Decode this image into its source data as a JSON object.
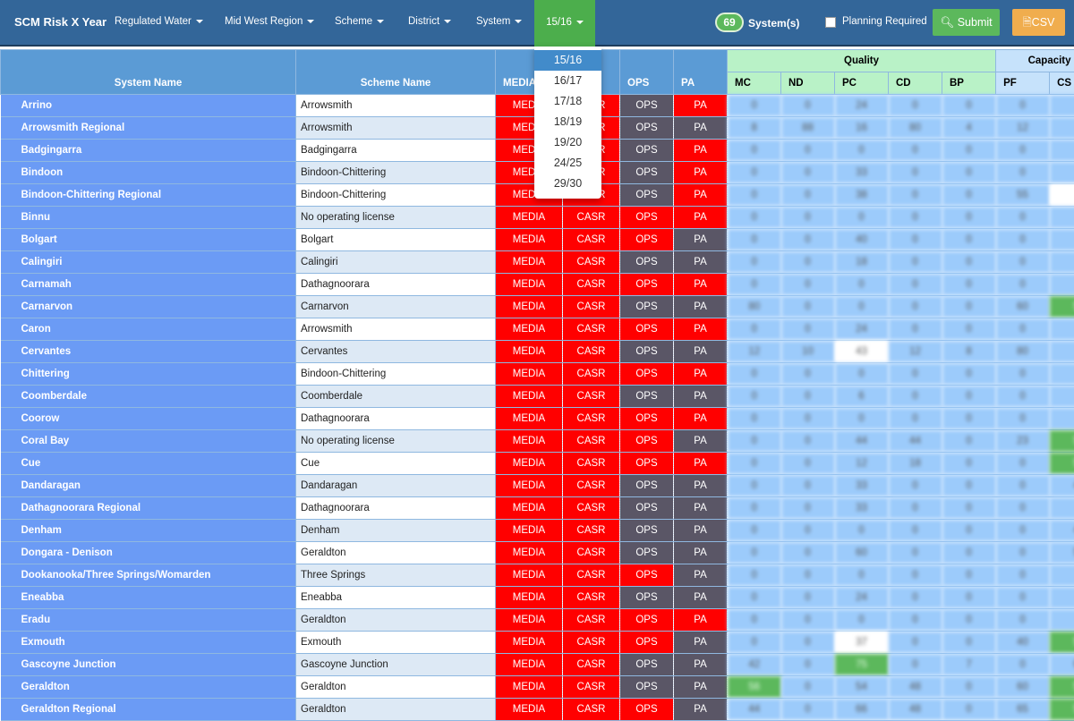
{
  "nav": {
    "title": "SCM Risk X Year",
    "filters": [
      "Regulated Water",
      "Mid West Region",
      "Scheme",
      "District",
      "System"
    ],
    "year": "15/16",
    "system_count": "69",
    "system_label": "System(s)",
    "planning_label": "Planning Required",
    "planning_checked": false,
    "submit_label": "Submit",
    "csv_label": "CSV"
  },
  "year_menu": {
    "options": [
      "15/16",
      "16/17",
      "17/18",
      "18/19",
      "19/20",
      "24/25",
      "29/30"
    ],
    "selected": "15/16"
  },
  "colors": {
    "navbar": "#336699",
    "red": "#ff0000",
    "dark": "#5a5666",
    "green": "#5cb85c",
    "orange": "#f0ad4e"
  },
  "table": {
    "headers": {
      "system": "System Name",
      "scheme": "Scheme Name",
      "media": "MEDIA",
      "casr": "CASR",
      "ops": "OPS",
      "pa": "PA",
      "quality": "Quality",
      "capacity": "Capacity",
      "quality_cols": [
        "MC",
        "ND",
        "PC",
        "CD",
        "BP"
      ],
      "capacity_cols": [
        "PF",
        "CS"
      ]
    },
    "rows": [
      {
        "system": "Arrino",
        "scheme": "Arrowsmith",
        "ops": "dark",
        "pa": "red",
        "v": [
          "0",
          "0",
          "24",
          "0",
          "0",
          "0",
          ""
        ],
        "hl": {}
      },
      {
        "system": "Arrowsmith Regional",
        "scheme": "Arrowsmith",
        "ops": "dark",
        "pa": "dark",
        "v": [
          "8",
          "88",
          "16",
          "80",
          "4",
          "12",
          ""
        ],
        "hl": {}
      },
      {
        "system": "Badgingarra",
        "scheme": "Badgingarra",
        "ops": "dark",
        "pa": "red",
        "v": [
          "0",
          "0",
          "0",
          "0",
          "0",
          "0",
          ""
        ],
        "hl": {}
      },
      {
        "system": "Bindoon",
        "scheme": "Bindoon-Chittering",
        "ops": "dark",
        "pa": "red",
        "v": [
          "0",
          "0",
          "33",
          "0",
          "0",
          "0",
          ""
        ],
        "hl": {}
      },
      {
        "system": "Bindoon-Chittering Regional",
        "scheme": "Bindoon-Chittering",
        "ops": "dark",
        "pa": "red",
        "v": [
          "0",
          "0",
          "38",
          "0",
          "0",
          "55",
          ""
        ],
        "hl": {
          "6": "white"
        }
      },
      {
        "system": "Binnu",
        "scheme": "No operating license",
        "ops": "red",
        "pa": "red",
        "v": [
          "0",
          "0",
          "0",
          "0",
          "0",
          "0",
          ""
        ],
        "hl": {}
      },
      {
        "system": "Bolgart",
        "scheme": "Bolgart",
        "ops": "red",
        "pa": "dark",
        "v": [
          "0",
          "0",
          "40",
          "0",
          "0",
          "0",
          ""
        ],
        "hl": {}
      },
      {
        "system": "Calingiri",
        "scheme": "Calingiri",
        "ops": "dark",
        "pa": "dark",
        "v": [
          "0",
          "0",
          "18",
          "0",
          "0",
          "0",
          ""
        ],
        "hl": {}
      },
      {
        "system": "Carnamah",
        "scheme": "Dathagnoorara",
        "ops": "red",
        "pa": "red",
        "v": [
          "0",
          "0",
          "0",
          "0",
          "0",
          "0",
          ""
        ],
        "hl": {}
      },
      {
        "system": "Carnarvon",
        "scheme": "Carnarvon",
        "ops": "dark",
        "pa": "dark",
        "v": [
          "80",
          "0",
          "0",
          "0",
          "0",
          "60",
          "5"
        ],
        "hl": {
          "6": "green"
        }
      },
      {
        "system": "Caron",
        "scheme": "Arrowsmith",
        "ops": "red",
        "pa": "red",
        "v": [
          "0",
          "0",
          "24",
          "0",
          "0",
          "0",
          ""
        ],
        "hl": {}
      },
      {
        "system": "Cervantes",
        "scheme": "Cervantes",
        "ops": "dark",
        "pa": "dark",
        "v": [
          "12",
          "10",
          "43",
          "12",
          "8",
          "80",
          ""
        ],
        "hl": {
          "2": "white"
        }
      },
      {
        "system": "Chittering",
        "scheme": "Bindoon-Chittering",
        "ops": "red",
        "pa": "red",
        "v": [
          "0",
          "0",
          "0",
          "0",
          "0",
          "0",
          ""
        ],
        "hl": {}
      },
      {
        "system": "Coomberdale",
        "scheme": "Coomberdale",
        "ops": "dark",
        "pa": "dark",
        "v": [
          "0",
          "0",
          "6",
          "0",
          "0",
          "0",
          ""
        ],
        "hl": {}
      },
      {
        "system": "Coorow",
        "scheme": "Dathagnoorara",
        "ops": "red",
        "pa": "red",
        "v": [
          "0",
          "0",
          "0",
          "0",
          "0",
          "0",
          ""
        ],
        "hl": {}
      },
      {
        "system": "Coral Bay",
        "scheme": "No operating license",
        "ops": "red",
        "pa": "dark",
        "v": [
          "0",
          "0",
          "44",
          "44",
          "0",
          "23",
          "5"
        ],
        "hl": {
          "6": "green"
        }
      },
      {
        "system": "Cue",
        "scheme": "Cue",
        "ops": "red",
        "pa": "red",
        "v": [
          "0",
          "0",
          "12",
          "18",
          "0",
          "0",
          "5"
        ],
        "hl": {
          "6": "green"
        }
      },
      {
        "system": "Dandaragan",
        "scheme": "Dandaragan",
        "ops": "dark",
        "pa": "dark",
        "v": [
          "0",
          "0",
          "33",
          "0",
          "0",
          "0",
          "4"
        ],
        "hl": {}
      },
      {
        "system": "Dathagnoorara Regional",
        "scheme": "Dathagnoorara",
        "ops": "dark",
        "pa": "dark",
        "v": [
          "0",
          "0",
          "33",
          "0",
          "0",
          "0",
          ""
        ],
        "hl": {}
      },
      {
        "system": "Denham",
        "scheme": "Denham",
        "ops": "dark",
        "pa": "dark",
        "v": [
          "0",
          "0",
          "0",
          "0",
          "0",
          "0",
          "4"
        ],
        "hl": {}
      },
      {
        "system": "Dongara - Denison",
        "scheme": "Geraldton",
        "ops": "dark",
        "pa": "dark",
        "v": [
          "0",
          "0",
          "60",
          "0",
          "0",
          "0",
          "5"
        ],
        "hl": {}
      },
      {
        "system": "Dookanooka/Three Springs/Womarden",
        "scheme": "Three Springs",
        "ops": "red",
        "pa": "dark",
        "v": [
          "0",
          "0",
          "0",
          "0",
          "0",
          "0",
          ""
        ],
        "hl": {}
      },
      {
        "system": "Eneabba",
        "scheme": "Eneabba",
        "ops": "dark",
        "pa": "dark",
        "v": [
          "0",
          "0",
          "24",
          "0",
          "0",
          "0",
          ""
        ],
        "hl": {}
      },
      {
        "system": "Eradu",
        "scheme": "Geraldton",
        "ops": "red",
        "pa": "red",
        "v": [
          "0",
          "0",
          "0",
          "0",
          "0",
          "0",
          ""
        ],
        "hl": {}
      },
      {
        "system": "Exmouth",
        "scheme": "Exmouth",
        "ops": "red",
        "pa": "dark",
        "v": [
          "0",
          "0",
          "37",
          "0",
          "0",
          "40",
          "5"
        ],
        "hl": {
          "2": "white",
          "6": "green"
        }
      },
      {
        "system": "Gascoyne Junction",
        "scheme": "Gascoyne Junction",
        "ops": "dark",
        "pa": "dark",
        "v": [
          "42",
          "0",
          "75",
          "0",
          "7",
          "0",
          "6"
        ],
        "hl": {
          "2": "green"
        }
      },
      {
        "system": "Geraldton",
        "scheme": "Geraldton",
        "ops": "dark",
        "pa": "dark",
        "v": [
          "56",
          "0",
          "54",
          "48",
          "0",
          "60",
          "5"
        ],
        "hl": {
          "0": "green",
          "6": "green"
        }
      },
      {
        "system": "Geraldton Regional",
        "scheme": "Geraldton",
        "ops": "red",
        "pa": "dark",
        "v": [
          "44",
          "0",
          "66",
          "48",
          "0",
          "65",
          "5"
        ],
        "hl": {
          "6": "green"
        }
      }
    ]
  }
}
